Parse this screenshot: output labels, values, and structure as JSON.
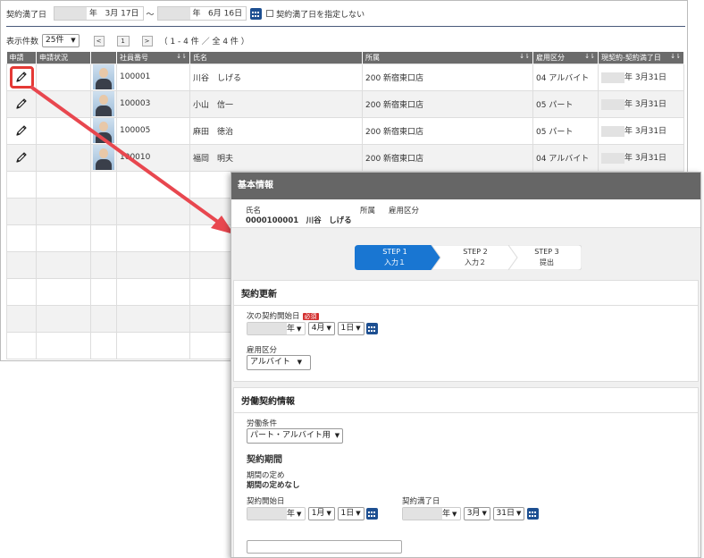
{
  "filter": {
    "label": "契約満了日",
    "from_year_suffix": "年",
    "from_date": "3月 17日",
    "tilde": "～",
    "to_year_suffix": "年",
    "to_date": "6月 16日",
    "unspecified_checkbox_label": "契約満了日を指定しない",
    "unspecified_checked": false
  },
  "pager": {
    "display_count_label": "表示件数",
    "display_count_value": "25件",
    "current_page": "1",
    "range_text": "（ 1 - 4 件 ／ 全 4 件 ）"
  },
  "table": {
    "headers": [
      "申請",
      "申請状況",
      "",
      "社員番号",
      "氏名",
      "所属",
      "雇用区分",
      "現契約-契約満了日"
    ],
    "rows": [
      {
        "emp_no": "100001",
        "name": "川谷　しげる",
        "dept": "200 新宿東口店",
        "type": "04 アルバイト",
        "end_suffix": "年 3月31日"
      },
      {
        "emp_no": "100003",
        "name": "小山　信一",
        "dept": "200 新宿東口店",
        "type": "05 パート",
        "end_suffix": "年 3月31日"
      },
      {
        "emp_no": "100005",
        "name": "麻田　徳治",
        "dept": "200 新宿東口店",
        "type": "05 パート",
        "end_suffix": "年 3月31日"
      },
      {
        "emp_no": "100010",
        "name": "福岡　明夫",
        "dept": "200 新宿東口店",
        "type": "04 アルバイト",
        "end_suffix": "年 3月31日"
      }
    ],
    "empty_row_count": 7
  },
  "panel": {
    "title": "基本情報",
    "name_label": "氏名",
    "name_value": "0000100001　川谷　しげる",
    "dept_label": "所属",
    "type_label": "雇用区分",
    "steps": [
      {
        "step": "STEP 1",
        "label": "入力１",
        "active": true
      },
      {
        "step": "STEP 2",
        "label": "入力２",
        "active": false
      },
      {
        "step": "STEP 3",
        "label": "提出",
        "active": false
      }
    ],
    "renewal": {
      "title": "契約更新",
      "next_start_label": "次の契約開始日",
      "required_badge": "必須",
      "year_suffix": "年",
      "month": "4月",
      "day": "1日",
      "employment_label": "雇用区分",
      "employment_value": "アルバイト"
    },
    "labor": {
      "title": "労働契約情報",
      "condition_label": "労働条件",
      "condition_value": "パート・アルバイト用",
      "period_title": "契約期間",
      "period_def_label": "期間の定め",
      "period_def_value": "期間の定めなし",
      "start_label": "契約開始日",
      "start_year_suffix": "年",
      "start_month": "1月",
      "start_day": "1日",
      "end_label": "契約満了日",
      "end_year_suffix": "年",
      "end_month": "3月",
      "end_day": "31日"
    }
  },
  "colors": {
    "header_gray": "#666666",
    "step_active": "#1976d2",
    "highlight_red": "#e53935",
    "calendar_blue": "#1d4f91"
  }
}
